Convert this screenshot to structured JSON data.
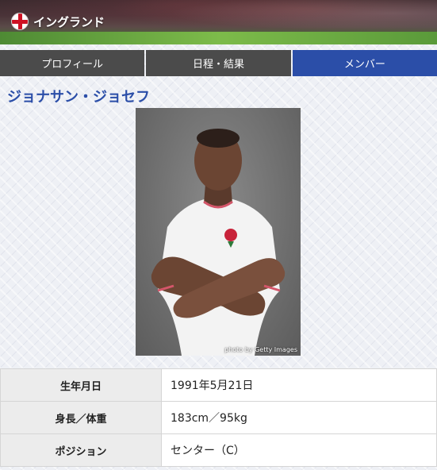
{
  "header": {
    "team_name": "イングランド",
    "flag_icon": "england-flag-icon"
  },
  "tabs": [
    {
      "label": "プロフィール",
      "active": false
    },
    {
      "label": "日程・結果",
      "active": false
    },
    {
      "label": "メンバー",
      "active": true
    }
  ],
  "player": {
    "name": "ジョナサン・ジョセフ",
    "photo_credit": "photo by Getty Images"
  },
  "profile_rows": [
    {
      "label": "生年月日",
      "value": "1991年5月21日"
    },
    {
      "label": "身長／体重",
      "value": "183cm／95kg"
    },
    {
      "label": "ポジション",
      "value": "センター（C）"
    }
  ],
  "colors": {
    "accent": "#2b4ea8",
    "tab_inactive": "#4b4b4b",
    "flag_red": "#ce1124"
  }
}
